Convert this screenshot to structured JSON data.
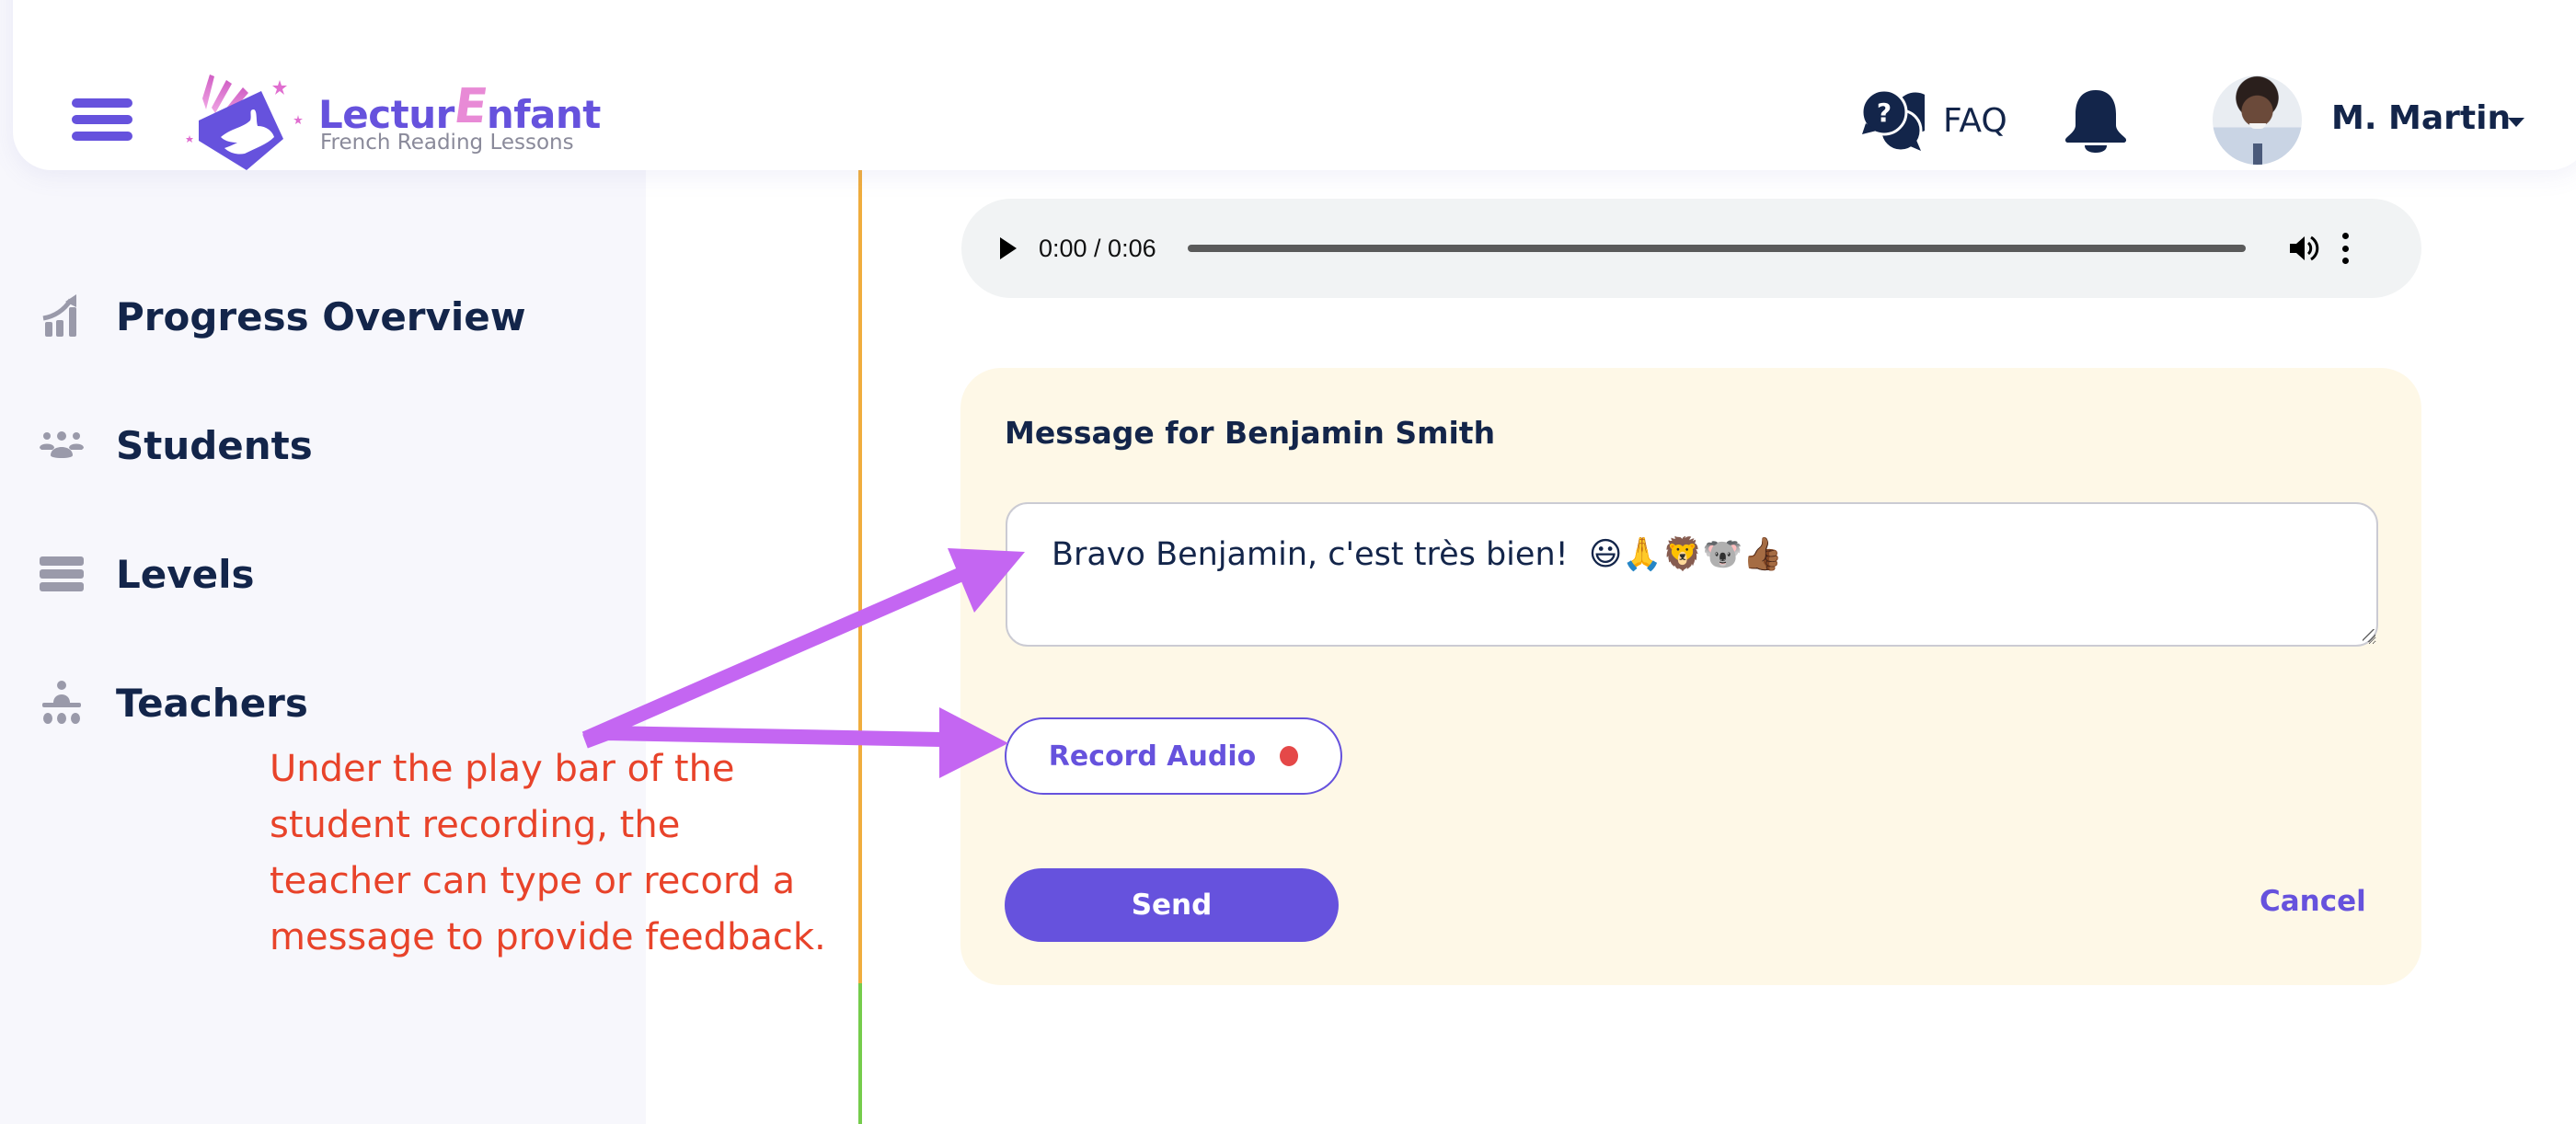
{
  "header": {
    "brand_prefix": "Lectur",
    "brand_e": "E",
    "brand_suffix": "nfant",
    "tagline": "French Reading Lessons",
    "faq_label": "FAQ",
    "user_name": "M. Martin",
    "icons": {
      "menu": "hamburger-menu-icon",
      "logo": "book-hand-logo",
      "faq": "question-chat-bubbles-icon",
      "notifications": "bell-icon",
      "user_menu": "caret-down-icon"
    }
  },
  "sidebar": {
    "items": [
      {
        "label": "Progress Overview",
        "icon": "chart-growth-icon"
      },
      {
        "label": "Students",
        "icon": "group-users-icon"
      },
      {
        "label": "Levels",
        "icon": "layers-bars-icon"
      },
      {
        "label": "Teachers",
        "icon": "teacher-classroom-icon"
      }
    ]
  },
  "audio_player": {
    "current_time": "0:00",
    "duration": "0:06",
    "time_display": "0:00 / 0:06",
    "progress": 0,
    "icons": {
      "play": "play-icon",
      "volume": "volume-icon",
      "more": "more-options-icon"
    }
  },
  "message_card": {
    "title": "Message for Benjamin Smith",
    "message_value": "Bravo Benjamin, c'est très bien!  😃🙏🦁🐨👍🏾",
    "record_label": "Record Audio",
    "send_label": "Send",
    "cancel_label": "Cancel"
  },
  "annotation": {
    "text": "Under the play bar of the\nstudent recording, the\nteacher can type or record a\nmessage to provide feedback."
  },
  "colors": {
    "brand": "#6652dd",
    "brand_pink": "#e88ad6",
    "text_dark": "#13254a",
    "card_bg": "#fef8e7",
    "record_dot": "#e54848",
    "annotation_text": "#e8432a",
    "annotation_arrow": "#c466f2",
    "timeline_orange": "#f0ad3e",
    "timeline_green": "#75cc4c"
  }
}
